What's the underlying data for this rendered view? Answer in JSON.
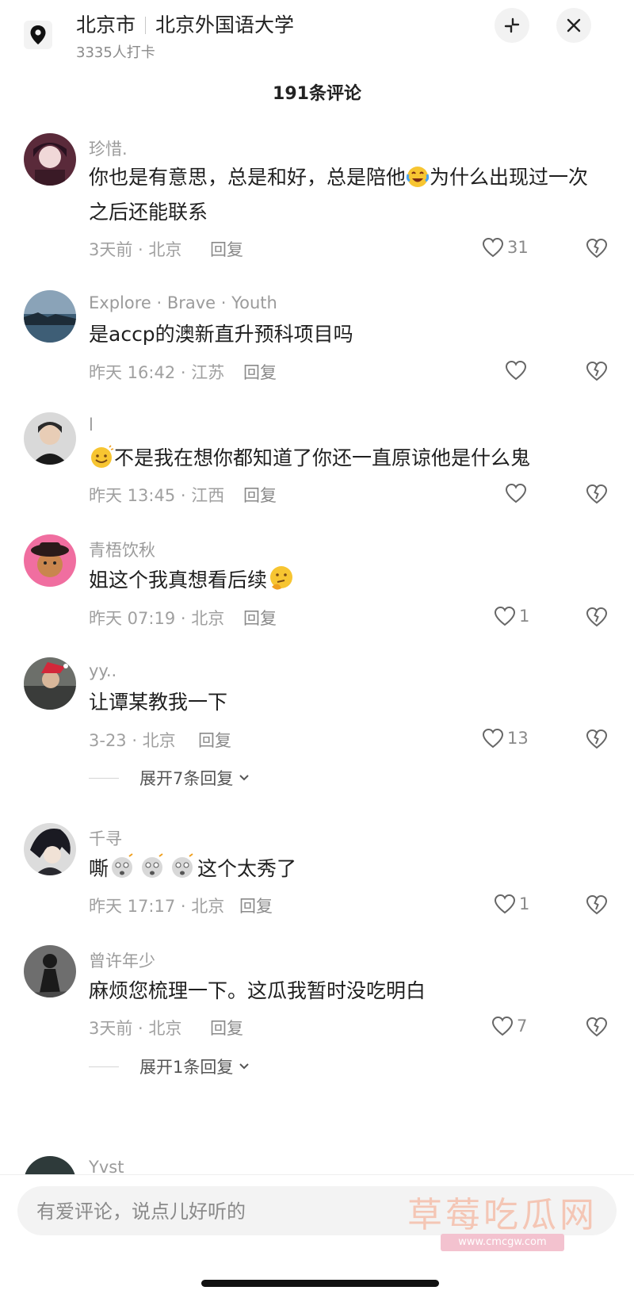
{
  "header": {
    "city": "北京市",
    "place": "北京外国语大学",
    "checkins": "3335人打卡",
    "icons": {
      "location": "location-pin-icon",
      "collapse": "collapse-icon",
      "close": "close-icon"
    }
  },
  "comments_title": "191条评论",
  "reply_label": "回复",
  "comments": [
    {
      "user": "珍惜.",
      "text_a": "你也是有意思，总是和好，总是陪他",
      "emoji": "crying-laughing-emoji",
      "text_b": "为什么出现过一次之后还能联系",
      "time_location": "3天前 · 北京",
      "likes": "31"
    },
    {
      "user": "Explore · Brave · Youth",
      "text": "是accp的澳新直升预科项目吗",
      "time_location": "昨天 16:42 · 江苏",
      "likes": ""
    },
    {
      "user": "l",
      "emoji": "smile-emoji",
      "text": "不是我在想你都知道了你还一直原谅他是什么鬼",
      "time_location": "昨天 13:45 · 江西",
      "likes": ""
    },
    {
      "user": "青梧饮秋",
      "text": "姐这个我真想看后续",
      "emoji": "thinking-emoji",
      "time_location": "昨天 07:19 · 北京",
      "likes": "1"
    },
    {
      "user": "yy..",
      "text": "让谭某教我一下",
      "time_location": "3-23 · 北京",
      "likes": "13",
      "expand": "展开7条回复"
    },
    {
      "user": "千寻",
      "text_a": "嘶",
      "emoji": "shocked-emoji",
      "text_b": "这个太秀了",
      "time_location": "昨天 17:17 · 北京",
      "likes": "1"
    },
    {
      "user": "曾许年少",
      "text": "麻烦您梳理一下。这瓜我暂时没吃明白",
      "time_location": "3天前 · 北京",
      "likes": "7",
      "expand": "展开1条回复"
    },
    {
      "user": "Yvst"
    }
  ],
  "input": {
    "placeholder": "有爱评论，说点儿好听的"
  },
  "watermark": {
    "text": "草莓吃瓜网",
    "url": "www.cmcgw.com"
  }
}
